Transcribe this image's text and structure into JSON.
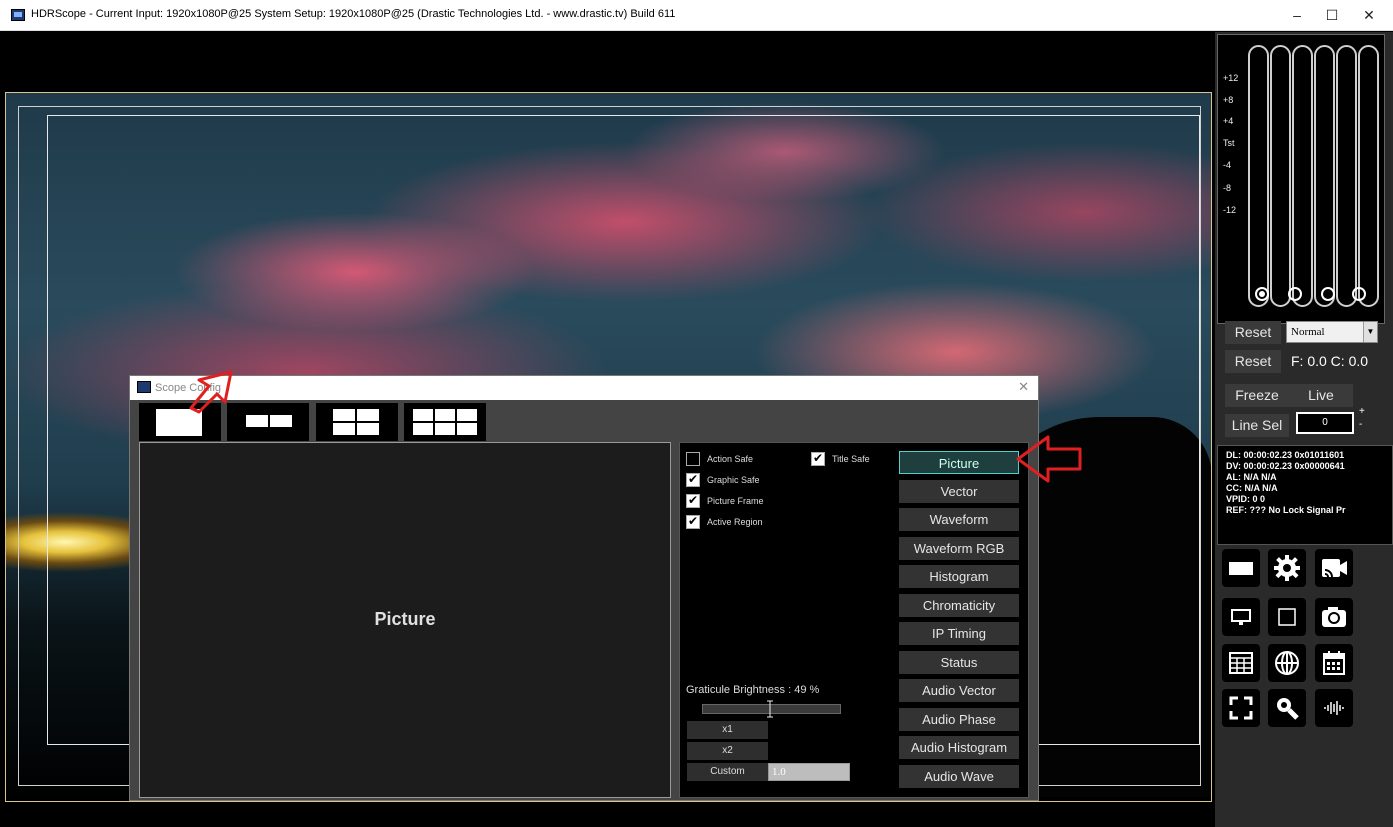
{
  "window": {
    "title": "HDRScope - Current Input: 1920x1080P@25  System Setup: 1920x1080P@25    (Drastic Technologies Ltd. - www.drastic.tv) Build 611",
    "minimize": "–",
    "maximize": "☐",
    "close": "✕"
  },
  "meters": {
    "labels": [
      "+12",
      "+8",
      "+4",
      "Tst",
      "-4",
      "-8",
      "-12"
    ]
  },
  "controls": {
    "reset1": "Reset",
    "mode_value": "Normal",
    "reset2": "Reset",
    "fc_text": "F: 0.0  C: 0.0",
    "freeze": "Freeze",
    "live": "Live",
    "line_sel": "Line Sel",
    "line_value": "0",
    "plus": "+",
    "minus": "-"
  },
  "info": {
    "lines": [
      "DL:  00:00:02.23   0x01011601",
      "DV:  00:00:02.23   0x00000641",
      "AL:  N/A                 N/A",
      "CC:  N/A                 N/A",
      "VPID:   0                0",
      "REF:    ???      No Lock Signal Pr"
    ]
  },
  "toolbar": {
    "icons": [
      "display-icon",
      "gear-icon",
      "cast-icon",
      "monitor-icon",
      "square-icon",
      "camera-icon",
      "table-icon",
      "globe-icon",
      "calendar-icon",
      "fullscreen-icon",
      "search-icon",
      "audio-wave-icon"
    ]
  },
  "dialog": {
    "title": "Scope Config",
    "close": "✕",
    "preview_label": "Picture",
    "checkboxes": {
      "action_safe": "Action Safe",
      "title_safe": "Title Safe",
      "graphic_safe": "Graphic Safe",
      "picture_frame": "Picture Frame",
      "active_region": "Active Region"
    },
    "graticule_label": "Graticule Brightness : 49 %",
    "graticule_value": 0.49,
    "zoom": {
      "x1": "x1",
      "x2": "x2",
      "custom": "Custom",
      "custom_value": "1.0"
    },
    "scopes": [
      "Picture",
      "Vector",
      "Waveform",
      "Waveform RGB",
      "Histogram",
      "Chromaticity",
      "IP Timing",
      "Status",
      "Audio Vector",
      "Audio Phase",
      "Audio Histogram",
      "Audio Wave"
    ]
  },
  "colors": {
    "accent": "#4fd0d0",
    "arrow": "#e02020"
  }
}
